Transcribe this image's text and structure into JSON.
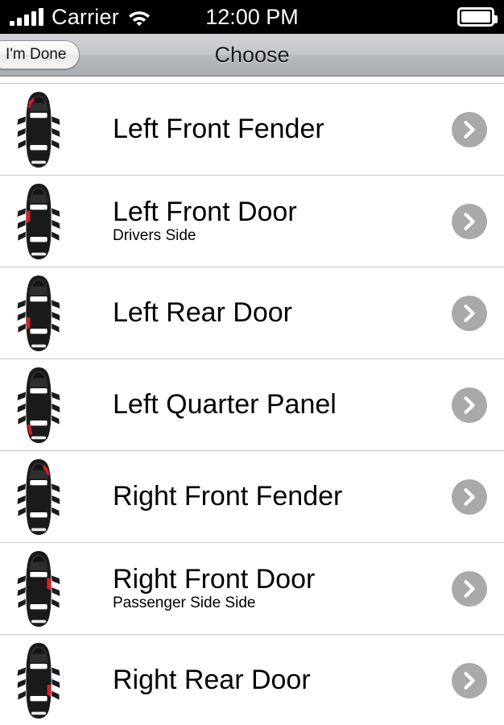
{
  "status_bar": {
    "carrier": "Carrier",
    "time": "12:00 PM",
    "signal_icon": "signal-bars-icon",
    "signal_bars": 5,
    "wifi_icon": "wifi-icon",
    "battery_icon": "battery-icon",
    "battery_level": 100,
    "background": "#000000",
    "foreground": "#ffffff"
  },
  "navbar": {
    "title": "Choose",
    "done_button_label": "I'm Done",
    "back_icon": "chevron-left-icon"
  },
  "colors": {
    "accent_red": "#d81f26",
    "car_body": "#1a1a1a",
    "chevron_circle": "#a9a9a9",
    "separator": "#c8c8c8",
    "navbar_text": "#19191b",
    "row_background": "#ffffff"
  },
  "list": {
    "rows": [
      {
        "title": "Left Front Fender",
        "subtitle": "",
        "icon": "car-top-view-icon",
        "highlight": "left-front-fender",
        "accessory": "chevron-right-icon"
      },
      {
        "title": "Left Front Door",
        "subtitle": "Drivers Side",
        "icon": "car-top-view-icon",
        "highlight": "left-front-door",
        "accessory": "chevron-right-icon"
      },
      {
        "title": "Left Rear Door",
        "subtitle": "",
        "icon": "car-top-view-icon",
        "highlight": "left-rear-door",
        "accessory": "chevron-right-icon"
      },
      {
        "title": "Left Quarter Panel",
        "subtitle": "",
        "icon": "car-top-view-icon",
        "highlight": "left-quarter-panel",
        "accessory": "chevron-right-icon"
      },
      {
        "title": "Right Front Fender",
        "subtitle": "",
        "icon": "car-top-view-icon",
        "highlight": "right-front-fender",
        "accessory": "chevron-right-icon"
      },
      {
        "title": "Right Front Door",
        "subtitle": "Passenger Side Side",
        "icon": "car-top-view-icon",
        "highlight": "right-front-door",
        "accessory": "chevron-right-icon"
      },
      {
        "title": "Right Rear Door",
        "subtitle": "",
        "icon": "car-top-view-icon",
        "highlight": "right-rear-door",
        "accessory": "chevron-right-icon"
      }
    ]
  }
}
